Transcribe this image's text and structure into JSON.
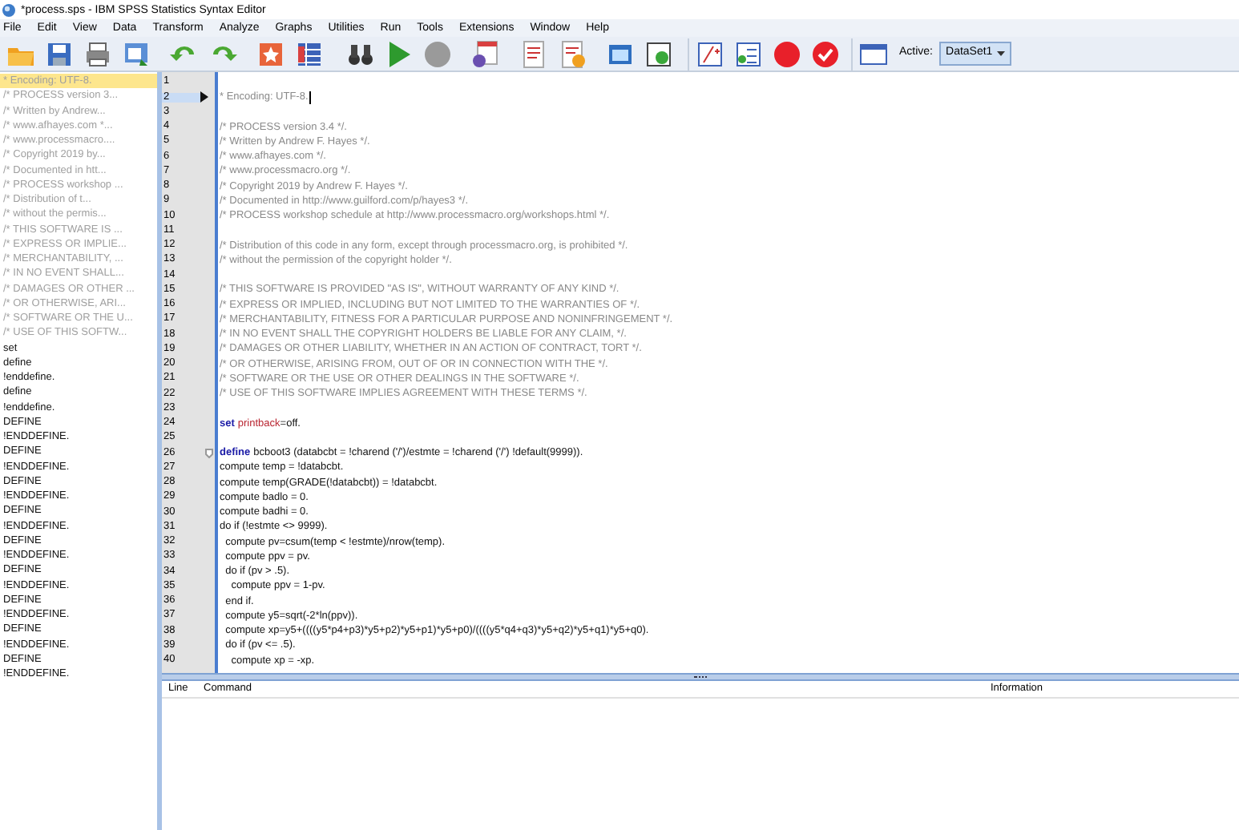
{
  "window": {
    "title": "*process.sps - IBM SPSS Statistics Syntax Editor"
  },
  "menu": [
    "File",
    "Edit",
    "View",
    "Data",
    "Transform",
    "Analyze",
    "Graphs",
    "Utilities",
    "Run",
    "Tools",
    "Extensions",
    "Window",
    "Help"
  ],
  "toolbar": {
    "active_label": "Active:",
    "dataset": "DataSet1"
  },
  "navigator": [
    {
      "text": "* Encoding: UTF-8.",
      "kind": "comment",
      "selected": true
    },
    {
      "text": "/* PROCESS version 3...",
      "kind": "comment",
      "selected": false
    },
    {
      "text": "/* Written by Andrew...",
      "kind": "comment",
      "selected": false
    },
    {
      "text": "/* www.afhayes.com *...",
      "kind": "comment",
      "selected": false
    },
    {
      "text": "/* www.processmacro....",
      "kind": "comment",
      "selected": false
    },
    {
      "text": "/* Copyright 2019 by...",
      "kind": "comment",
      "selected": false
    },
    {
      "text": "/* Documented in htt...",
      "kind": "comment",
      "selected": false
    },
    {
      "text": "/* PROCESS workshop ...",
      "kind": "comment",
      "selected": false
    },
    {
      "text": "/* Distribution of t...",
      "kind": "comment",
      "selected": false
    },
    {
      "text": "/* without the permis...",
      "kind": "comment",
      "selected": false
    },
    {
      "text": "/* THIS SOFTWARE IS ...",
      "kind": "comment",
      "selected": false
    },
    {
      "text": "/* EXPRESS OR IMPLIE...",
      "kind": "comment",
      "selected": false
    },
    {
      "text": "/* MERCHANTABILITY, ...",
      "kind": "comment",
      "selected": false
    },
    {
      "text": "/* IN NO EVENT SHALL...",
      "kind": "comment",
      "selected": false
    },
    {
      "text": "/* DAMAGES OR OTHER ...",
      "kind": "comment",
      "selected": false
    },
    {
      "text": "/* OR OTHERWISE, ARI...",
      "kind": "comment",
      "selected": false
    },
    {
      "text": "/* SOFTWARE OR THE U...",
      "kind": "comment",
      "selected": false
    },
    {
      "text": "/* USE OF THIS SOFTW...",
      "kind": "comment",
      "selected": false
    },
    {
      "text": "set",
      "kind": "command",
      "selected": false
    },
    {
      "text": "define",
      "kind": "command",
      "selected": false
    },
    {
      "text": "!enddefine.",
      "kind": "command",
      "selected": false
    },
    {
      "text": "define",
      "kind": "command",
      "selected": false
    },
    {
      "text": "!enddefine.",
      "kind": "command",
      "selected": false
    },
    {
      "text": "DEFINE",
      "kind": "command",
      "selected": false
    },
    {
      "text": "!ENDDEFINE.",
      "kind": "command",
      "selected": false
    },
    {
      "text": "DEFINE",
      "kind": "command",
      "selected": false
    },
    {
      "text": "!ENDDEFINE.",
      "kind": "command",
      "selected": false
    },
    {
      "text": "DEFINE",
      "kind": "command",
      "selected": false
    },
    {
      "text": "!ENDDEFINE.",
      "kind": "command",
      "selected": false
    },
    {
      "text": "DEFINE",
      "kind": "command",
      "selected": false
    },
    {
      "text": "!ENDDEFINE.",
      "kind": "command",
      "selected": false
    },
    {
      "text": "DEFINE",
      "kind": "command",
      "selected": false
    },
    {
      "text": "!ENDDEFINE.",
      "kind": "command",
      "selected": false
    },
    {
      "text": "DEFINE",
      "kind": "command",
      "selected": false
    },
    {
      "text": "!ENDDEFINE.",
      "kind": "command",
      "selected": false
    },
    {
      "text": "DEFINE",
      "kind": "command",
      "selected": false
    },
    {
      "text": "!ENDDEFINE.",
      "kind": "command",
      "selected": false
    },
    {
      "text": "DEFINE",
      "kind": "command",
      "selected": false
    },
    {
      "text": "!ENDDEFINE.",
      "kind": "command",
      "selected": false
    },
    {
      "text": "DEFINE",
      "kind": "command",
      "selected": false
    },
    {
      "text": "!ENDDEFINE.",
      "kind": "command",
      "selected": false
    }
  ],
  "editor": {
    "lines": [
      {
        "number": "1",
        "current": false
      },
      {
        "number": "2",
        "current": true,
        "segments": [
          {
            "text": "* Encoding: UTF-8.",
            "kind": "comment"
          }
        ]
      },
      {
        "number": "3",
        "current": false
      },
      {
        "number": "4",
        "current": false,
        "segments": [
          {
            "text": "/* PROCESS version 3.4 */.",
            "kind": "comment"
          }
        ]
      },
      {
        "number": "5",
        "current": false,
        "segments": [
          {
            "text": "/* Written by Andrew F. Hayes */.",
            "kind": "comment"
          }
        ]
      },
      {
        "number": "6",
        "current": false,
        "segments": [
          {
            "text": "/* www.afhayes.com */.",
            "kind": "comment"
          }
        ]
      },
      {
        "number": "7",
        "current": false,
        "segments": [
          {
            "text": "/* www.processmacro.org */.",
            "kind": "comment"
          }
        ]
      },
      {
        "number": "8",
        "current": false,
        "segments": [
          {
            "text": "/* Copyright 2019 by Andrew F. Hayes */.",
            "kind": "comment"
          }
        ]
      },
      {
        "number": "9",
        "current": false,
        "segments": [
          {
            "text": "/* Documented in http://www.guilford.com/p/hayes3 */.",
            "kind": "comment"
          }
        ]
      },
      {
        "number": "10",
        "current": false,
        "segments": [
          {
            "text": "/* PROCESS workshop schedule at http://www.processmacro.org/workshops.html */.",
            "kind": "comment"
          }
        ]
      },
      {
        "number": "11",
        "current": false
      },
      {
        "number": "12",
        "current": false,
        "segments": [
          {
            "text": "/* Distribution of this code in any form, except through processmacro.org, is prohibited */.",
            "kind": "comment"
          }
        ]
      },
      {
        "number": "13",
        "current": false,
        "segments": [
          {
            "text": "/* without the permission of the copyright holder */.",
            "kind": "comment"
          }
        ]
      },
      {
        "number": "14",
        "current": false
      },
      {
        "number": "15",
        "current": false,
        "segments": [
          {
            "text": "/* THIS SOFTWARE IS PROVIDED \"AS IS\", WITHOUT WARRANTY OF ANY KIND */.",
            "kind": "comment"
          }
        ]
      },
      {
        "number": "16",
        "current": false,
        "segments": [
          {
            "text": "/* EXPRESS OR IMPLIED, INCLUDING BUT NOT LIMITED TO THE WARRANTIES OF */.",
            "kind": "comment"
          }
        ]
      },
      {
        "number": "17",
        "current": false,
        "segments": [
          {
            "text": "/* MERCHANTABILITY, FITNESS FOR A PARTICULAR PURPOSE AND NONINFRINGEMENT */.",
            "kind": "comment"
          }
        ]
      },
      {
        "number": "18",
        "current": false,
        "segments": [
          {
            "text": "/* IN NO EVENT SHALL THE COPYRIGHT HOLDERS BE LIABLE FOR ANY CLAIM, */.",
            "kind": "comment"
          }
        ]
      },
      {
        "number": "19",
        "current": false,
        "segments": [
          {
            "text": "/* DAMAGES OR OTHER LIABILITY, WHETHER IN AN ACTION OF CONTRACT, TORT */.",
            "kind": "comment"
          }
        ]
      },
      {
        "number": "20",
        "current": false,
        "segments": [
          {
            "text": "/* OR OTHERWISE, ARISING FROM, OUT OF OR IN CONNECTION WITH THE */.",
            "kind": "comment"
          }
        ]
      },
      {
        "number": "21",
        "current": false,
        "segments": [
          {
            "text": "/* SOFTWARE OR THE USE OR OTHER DEALINGS IN THE SOFTWARE */.",
            "kind": "comment"
          }
        ]
      },
      {
        "number": "22",
        "current": false,
        "segments": [
          {
            "text": "/* USE OF THIS SOFTWARE IMPLIES AGREEMENT WITH THESE TERMS */.",
            "kind": "comment"
          }
        ]
      },
      {
        "number": "23",
        "current": false
      },
      {
        "number": "24",
        "current": false,
        "segments": [
          {
            "text": "set",
            "kind": "keyword"
          },
          {
            "text": "printback",
            "kind": "subcommand"
          },
          {
            "text": "=off.",
            "kind": "code"
          }
        ]
      },
      {
        "number": "25",
        "current": false
      },
      {
        "number": "26",
        "current": false,
        "fold_start": true,
        "segments": [
          {
            "text": "define",
            "kind": "keyword"
          },
          {
            "text": "bcboot3 (databcbt = !charend ('/')/estmte = !charend ('/') !default(9999)).",
            "kind": "code"
          }
        ]
      },
      {
        "number": "27",
        "current": false,
        "segments": [
          {
            "text": "compute temp = !databcbt.",
            "kind": "code"
          }
        ]
      },
      {
        "number": "28",
        "current": false,
        "segments": [
          {
            "text": "compute temp(GRADE(!databcbt)) = !databcbt.",
            "kind": "code"
          }
        ]
      },
      {
        "number": "29",
        "current": false,
        "segments": [
          {
            "text": "compute badlo = 0.",
            "kind": "code"
          }
        ]
      },
      {
        "number": "30",
        "current": false,
        "segments": [
          {
            "text": "compute badhi = 0.",
            "kind": "code"
          }
        ]
      },
      {
        "number": "31",
        "current": false,
        "segments": [
          {
            "text": "do if (!estmte <> 9999).",
            "kind": "code"
          }
        ]
      },
      {
        "number": "32",
        "current": false,
        "segments": [
          {
            "text": "  compute pv=csum(temp < !estmte)/nrow(temp).",
            "kind": "code"
          }
        ]
      },
      {
        "number": "33",
        "current": false,
        "segments": [
          {
            "text": "  compute ppv = pv.",
            "kind": "code"
          }
        ]
      },
      {
        "number": "34",
        "current": false,
        "segments": [
          {
            "text": "  do if (pv > .5).",
            "kind": "code"
          }
        ]
      },
      {
        "number": "35",
        "current": false,
        "segments": [
          {
            "text": "    compute ppv = 1-pv.",
            "kind": "code"
          }
        ]
      },
      {
        "number": "36",
        "current": false,
        "segments": [
          {
            "text": "  end if.",
            "kind": "code"
          }
        ]
      },
      {
        "number": "37",
        "current": false,
        "segments": [
          {
            "text": "  compute y5=sqrt(-2*ln(ppv)).",
            "kind": "code"
          }
        ]
      },
      {
        "number": "38",
        "current": false,
        "segments": [
          {
            "text": "  compute xp=y5+((((y5*p4+p3)*y5+p2)*y5+p1)*y5+p0)/((((y5*q4+q3)*y5+q2)*y5+q1)*y5+q0).",
            "kind": "code"
          }
        ]
      },
      {
        "number": "39",
        "current": false,
        "segments": [
          {
            "text": "  do if (pv <= .5).",
            "kind": "code"
          }
        ]
      },
      {
        "number": "40",
        "current": false,
        "segments": [
          {
            "text": "    compute xp = -xp.",
            "kind": "code"
          }
        ]
      }
    ]
  },
  "error_pane": {
    "columns": [
      "Line",
      "Command",
      "Information"
    ]
  }
}
